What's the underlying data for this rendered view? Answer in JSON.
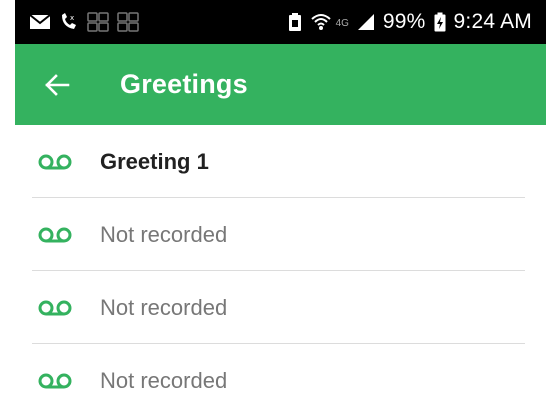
{
  "status_bar": {
    "battery_percent": "99%",
    "time": "9:24 AM",
    "network_label": "4G",
    "icons": [
      "mail-icon",
      "missed-call-icon",
      "app-notification-icon",
      "app-notification-icon",
      "battery-saver-icon",
      "wifi-icon",
      "signal-icon",
      "battery-charging-icon"
    ]
  },
  "app_bar": {
    "title": "Greetings",
    "back_icon": "arrow-left-icon",
    "color": "#34b25f"
  },
  "greetings": [
    {
      "label": "Greeting 1",
      "recorded": true
    },
    {
      "label": "Not recorded",
      "recorded": false
    },
    {
      "label": "Not recorded",
      "recorded": false
    },
    {
      "label": "Not recorded",
      "recorded": false
    }
  ],
  "colors": {
    "accent": "#34b25f",
    "text_primary": "#212121",
    "text_secondary": "#777777"
  }
}
